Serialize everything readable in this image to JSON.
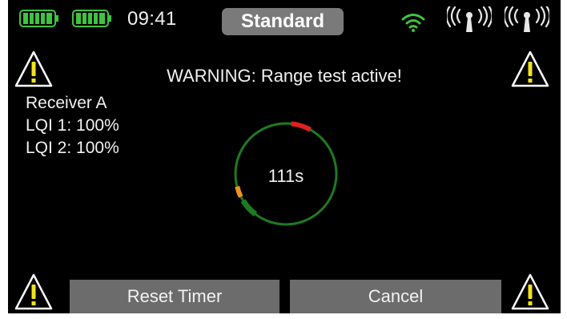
{
  "status_bar": {
    "time": "09:41",
    "profile": "Standard",
    "icons": [
      "battery-icon",
      "battery-icon",
      "wifi-icon",
      "antenna-icon",
      "antenna-icon"
    ]
  },
  "alert": {
    "message": "WARNING: Range test active!",
    "icon": "warning-icon"
  },
  "receiver": {
    "name": "Receiver A",
    "lqi1": "LQI 1: 100%",
    "lqi2": "LQI 2: 100%"
  },
  "timer": {
    "label": "111s"
  },
  "buttons": {
    "reset": "Reset Timer",
    "cancel": "Cancel"
  },
  "colors": {
    "ring": "#1e7a22",
    "marker_red": "#e02020",
    "marker_orange": "#f0921e",
    "button_bg": "#6c6c6c",
    "battery": "#3ec43e",
    "wifi": "#3ec43e"
  }
}
